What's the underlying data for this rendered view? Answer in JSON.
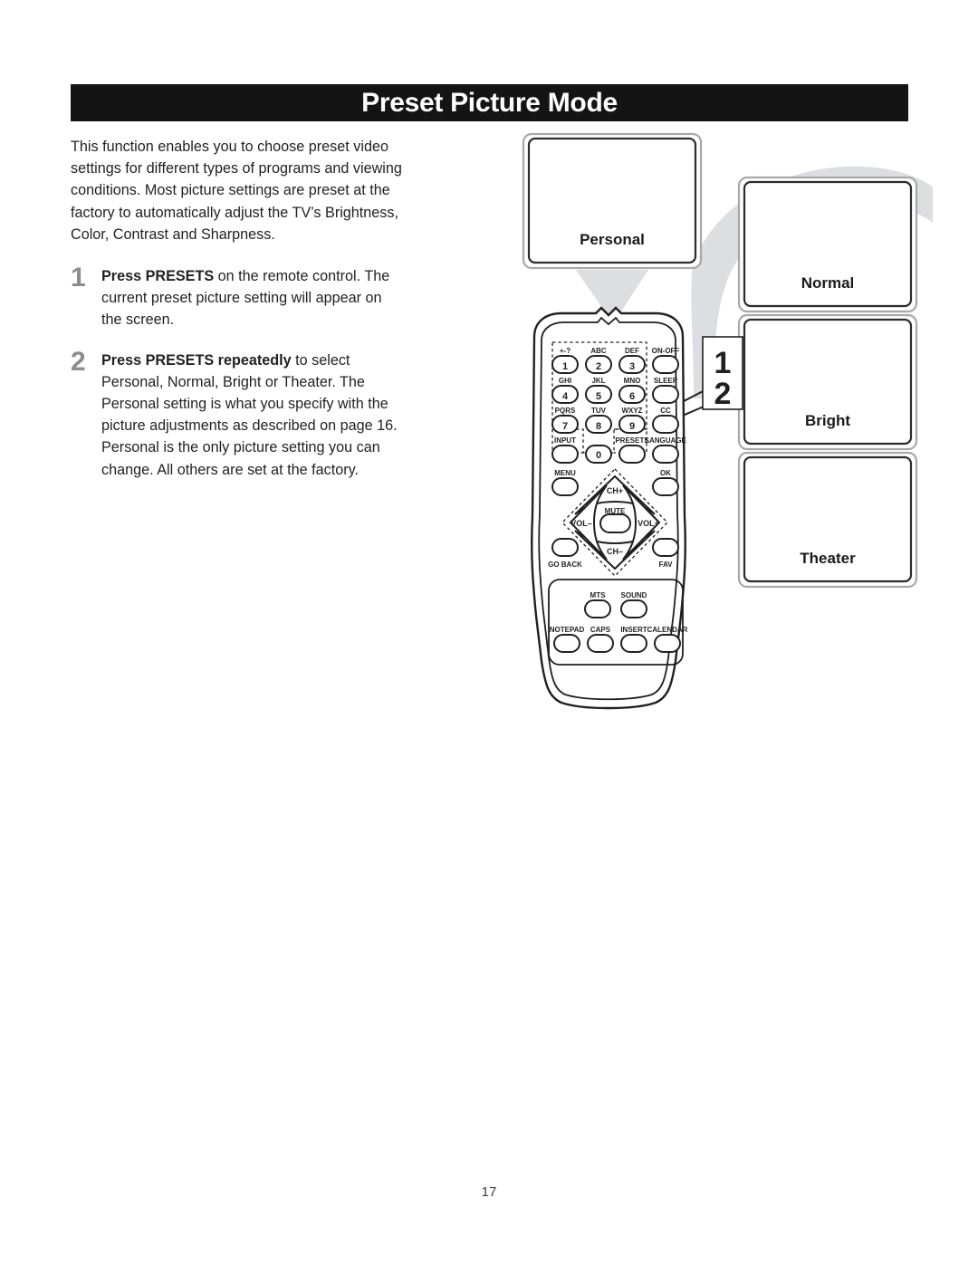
{
  "page": {
    "title": "Preset Picture Mode",
    "number": "17"
  },
  "content": {
    "intro": "This function enables you to choose preset video settings for different types of programs and viewing conditions. Most picture settings are preset at the factory to automatically adjust the TV’s Brightness, Color, Contrast and Sharpness.",
    "steps": [
      {
        "number": "1",
        "bold": "Press PRESETS",
        "rest": " on the remote control. The current preset picture setting will appear on the screen."
      },
      {
        "number": "2",
        "bold": "Press PRESETS repeatedly",
        "rest": " to select Personal, Normal, Bright or Theater. The Personal setting is what you specify with the picture adjustments as described on page 16. Personal is the only picture setting you can change. All others are set at the factory."
      }
    ]
  },
  "illustration": {
    "tv_screens": [
      {
        "label": "Personal"
      },
      {
        "label": "Normal"
      },
      {
        "label": "Bright"
      },
      {
        "label": "Theater"
      }
    ],
    "callout": {
      "line_one": "1",
      "line_two": "2"
    },
    "remote": {
      "keypad": [
        {
          "letters": "+-?",
          "digit": "1"
        },
        {
          "letters": "ABC",
          "digit": "2"
        },
        {
          "letters": "DEF",
          "digit": "3"
        },
        {
          "letters": "GHI",
          "digit": "4"
        },
        {
          "letters": "JKL",
          "digit": "5"
        },
        {
          "letters": "MNO",
          "digit": "6"
        },
        {
          "letters": "PQRS",
          "digit": "7"
        },
        {
          "letters": "TUV",
          "digit": "8"
        },
        {
          "letters": "WXYZ",
          "digit": "9"
        }
      ],
      "right_column": [
        "ON-OFF",
        "SLEEP",
        "CC"
      ],
      "row_input": [
        "INPUT",
        "0",
        "PRESETS",
        "LANGUAGE"
      ],
      "nav": {
        "menu": "MENU",
        "ok": "OK",
        "go_back": "GO BACK",
        "fav": "FAV",
        "up": "CH+",
        "down": "CH–",
        "left": "VOL–",
        "right": "VOL+",
        "center": "MUTE"
      },
      "bottom_upper": [
        "MTS",
        "SOUND"
      ],
      "bottom_lower": [
        "NOTEPAD",
        "CAPS",
        "INSERT",
        "CALENDAR"
      ]
    }
  },
  "colors": {
    "title_bar": "#141414",
    "title_text": "#ffffff",
    "step_number": "#8d8d8f",
    "body_text": "#231f20",
    "beam_gray": "#dcdee1",
    "line_dark": "#231f20",
    "screen_border": "#9a9a9a"
  }
}
